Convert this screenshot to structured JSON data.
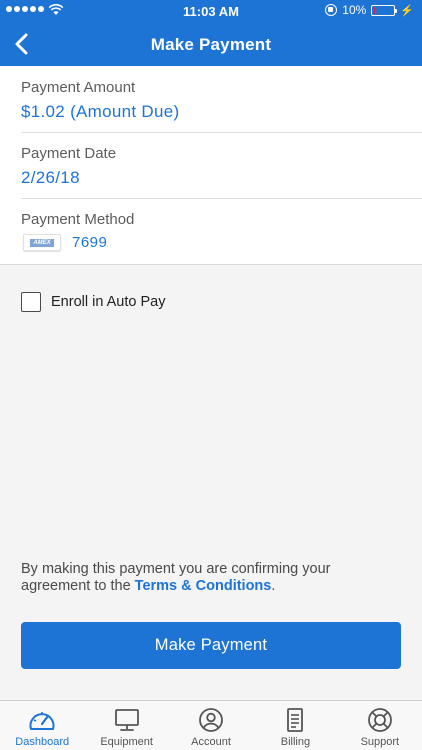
{
  "status_bar": {
    "time": "11:03 AM",
    "battery": "10%",
    "battery_level": 0.1
  },
  "nav": {
    "title": "Make Payment"
  },
  "details": {
    "amount": {
      "label": "Payment Amount",
      "value": "$1.02 (Amount Due)"
    },
    "date": {
      "label": "Payment Date",
      "value": "2/26/18"
    },
    "method": {
      "label": "Payment Method",
      "card_brand": "AMEX",
      "last_four": "7699"
    }
  },
  "autopay": {
    "label": "Enroll in Auto Pay",
    "checked": false
  },
  "agreement": {
    "text": "By making this payment you are confirming your agreement to the ",
    "link": "Terms & Conditions",
    "suffix": "."
  },
  "submit_label": "Make Payment",
  "tabs": [
    {
      "label": "Dashboard",
      "icon": "dashboard-icon",
      "active": true
    },
    {
      "label": "Equipment",
      "icon": "monitor-icon",
      "active": false
    },
    {
      "label": "Account",
      "icon": "account-icon",
      "active": false
    },
    {
      "label": "Billing",
      "icon": "billing-icon",
      "active": false
    },
    {
      "label": "Support",
      "icon": "support-icon",
      "active": false
    }
  ],
  "colors": {
    "primary": "#1d74d4",
    "battery_low": "#e8243a"
  }
}
